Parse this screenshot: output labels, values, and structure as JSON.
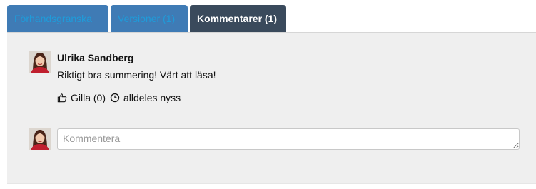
{
  "tabs": [
    {
      "label": "Förhandsgranska",
      "active": false
    },
    {
      "label": "Versioner (1)",
      "active": false
    },
    {
      "label": "Kommentarer (1)",
      "active": true
    }
  ],
  "comment": {
    "author": "Ulrika Sandberg",
    "text": "Riktigt bra summering! Värt att läsa!",
    "like_label": "Gilla (0)",
    "time": "alldeles nyss",
    "like_icon": "thumbs-up-icon",
    "time_icon": "clock-icon"
  },
  "compose": {
    "placeholder": "Kommentera",
    "value": ""
  },
  "colors": {
    "tab_inactive_bg": "#3f7bb5",
    "tab_inactive_text": "#1f9bd9",
    "tab_active_bg": "#3a4a5c",
    "panel_bg": "#efefef"
  }
}
